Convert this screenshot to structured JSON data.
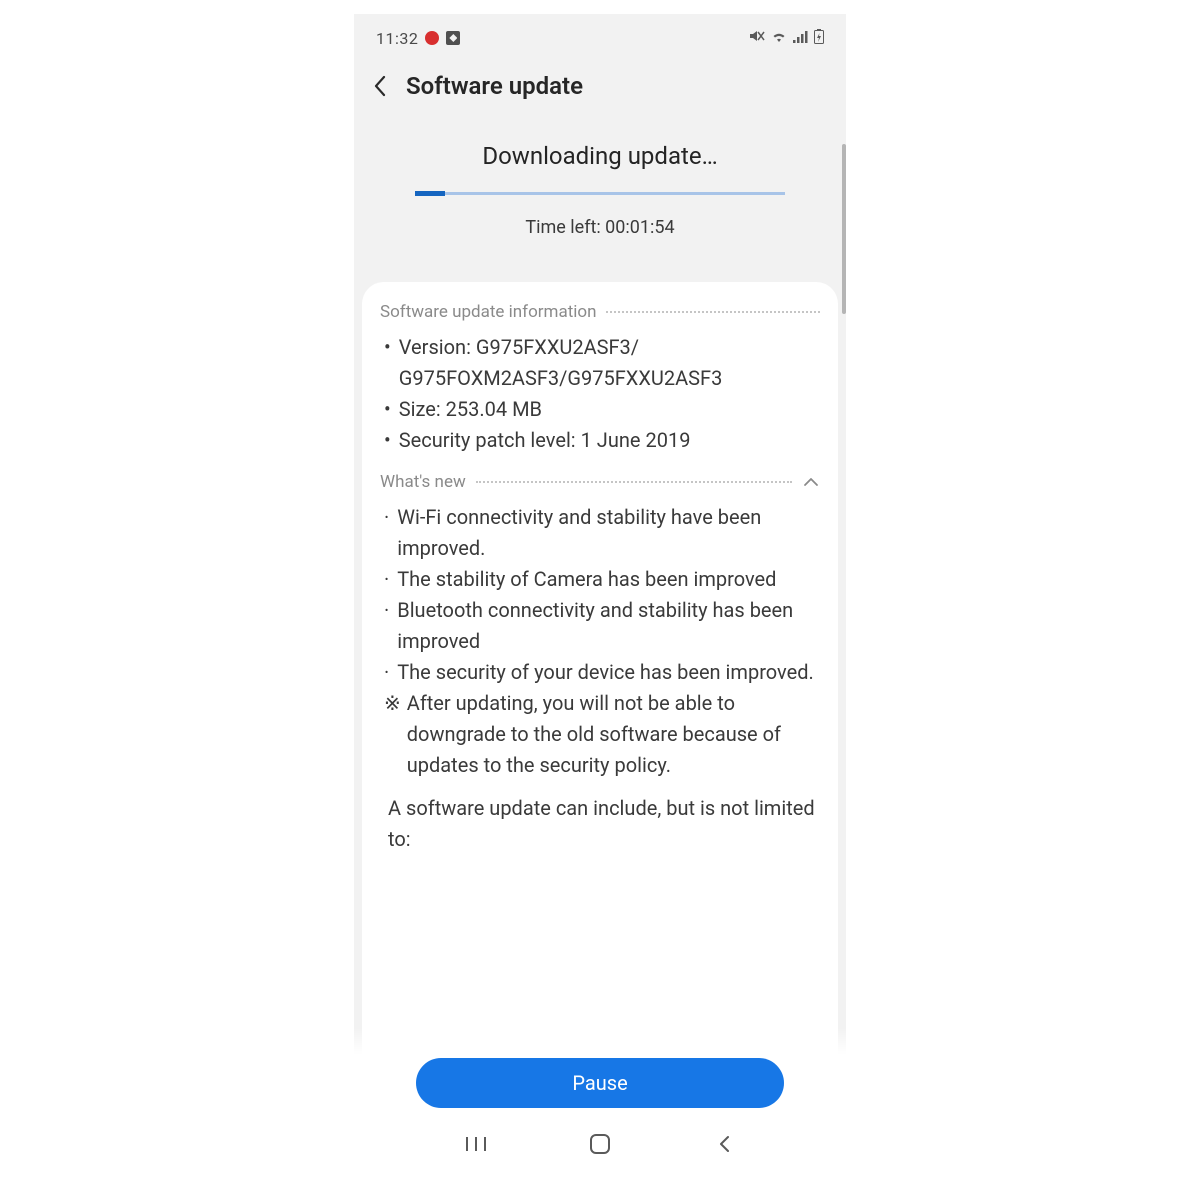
{
  "status_bar": {
    "time": "11:32"
  },
  "header": {
    "title": "Software update"
  },
  "download": {
    "title": "Downloading update…",
    "time_left_label": "Time left: 00:01:54",
    "progress_percent": 8
  },
  "info": {
    "section_label": "Software update information",
    "version_label": "Version: G975FXXU2ASF3/",
    "version_line2": "G975FOXM2ASF3/G975FXXU2ASF3",
    "size_label": "Size: 253.04 MB",
    "security_label": "Security patch level: 1 June 2019"
  },
  "whats_new": {
    "section_label": "What's new",
    "items": [
      "Wi-Fi connectivity and stability have been improved.",
      "The stability of Camera has been improved",
      "Bluetooth connectivity and stability has been improved",
      "The security of your device has been improved."
    ],
    "note": "After updating, you will not be able to downgrade to the old software because of updates to the security policy.",
    "footer": "A software update can include, but is not limited to:"
  },
  "buttons": {
    "pause": "Pause"
  }
}
